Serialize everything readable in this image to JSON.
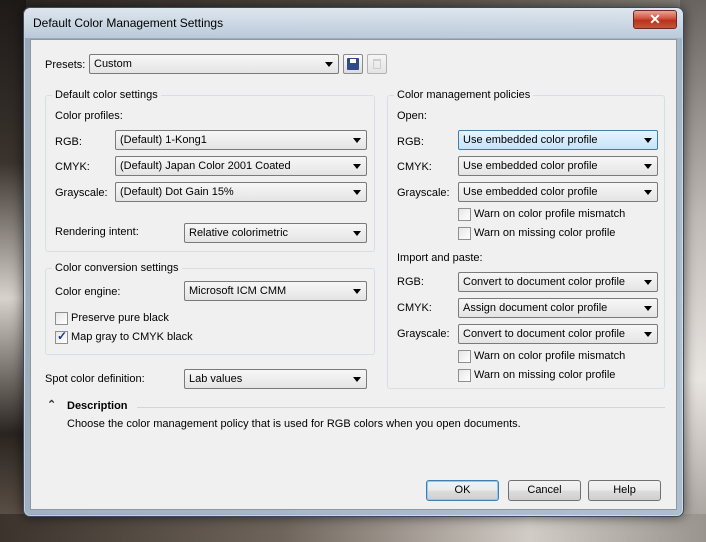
{
  "window": {
    "title": "Default Color Management Settings",
    "close_glyph": "✕"
  },
  "presets": {
    "label": "Presets:",
    "value": "Custom"
  },
  "default_color": {
    "title": "Default color settings",
    "profiles_label": "Color profiles:",
    "rgb_label": "RGB:",
    "rgb_value": "(Default) 1-Kong1",
    "cmyk_label": "CMYK:",
    "cmyk_value": "(Default) Japan Color 2001 Coated",
    "gray_label": "Grayscale:",
    "gray_value": "(Default) Dot Gain 15%",
    "intent_label": "Rendering intent:",
    "intent_value": "Relative colorimetric"
  },
  "conversion": {
    "title": "Color conversion settings",
    "engine_label": "Color engine:",
    "engine_value": "Microsoft ICM CMM",
    "preserve_black": {
      "label": "Preserve pure black",
      "checked": false
    },
    "map_gray": {
      "label": "Map gray to CMYK black",
      "checked": true
    }
  },
  "spot": {
    "label": "Spot color definition:",
    "value": "Lab values"
  },
  "policies": {
    "title": "Color management policies",
    "open": {
      "label": "Open:",
      "rgb_label": "RGB:",
      "rgb_value": "Use embedded color profile",
      "cmyk_label": "CMYK:",
      "cmyk_value": "Use embedded color profile",
      "gray_label": "Grayscale:",
      "gray_value": "Use embedded color profile",
      "warn_mismatch": {
        "label": "Warn on color profile mismatch",
        "checked": false
      },
      "warn_missing": {
        "label": "Warn on missing color profile",
        "checked": false
      }
    },
    "import": {
      "label": "Import and paste:",
      "rgb_label": "RGB:",
      "rgb_value": "Convert to document color profile",
      "cmyk_label": "CMYK:",
      "cmyk_value": "Assign document color profile",
      "gray_label": "Grayscale:",
      "gray_value": "Convert to document color profile",
      "warn_mismatch": {
        "label": "Warn on color profile mismatch",
        "checked": false
      },
      "warn_missing": {
        "label": "Warn on missing color profile",
        "checked": false
      }
    }
  },
  "description": {
    "title": "Description",
    "text": "Choose the color management policy that is used for RGB colors when you open documents.",
    "collapse_glyph": "⌃"
  },
  "buttons": {
    "ok": "OK",
    "cancel": "Cancel",
    "help": "Help"
  },
  "check_glyph": "✓"
}
